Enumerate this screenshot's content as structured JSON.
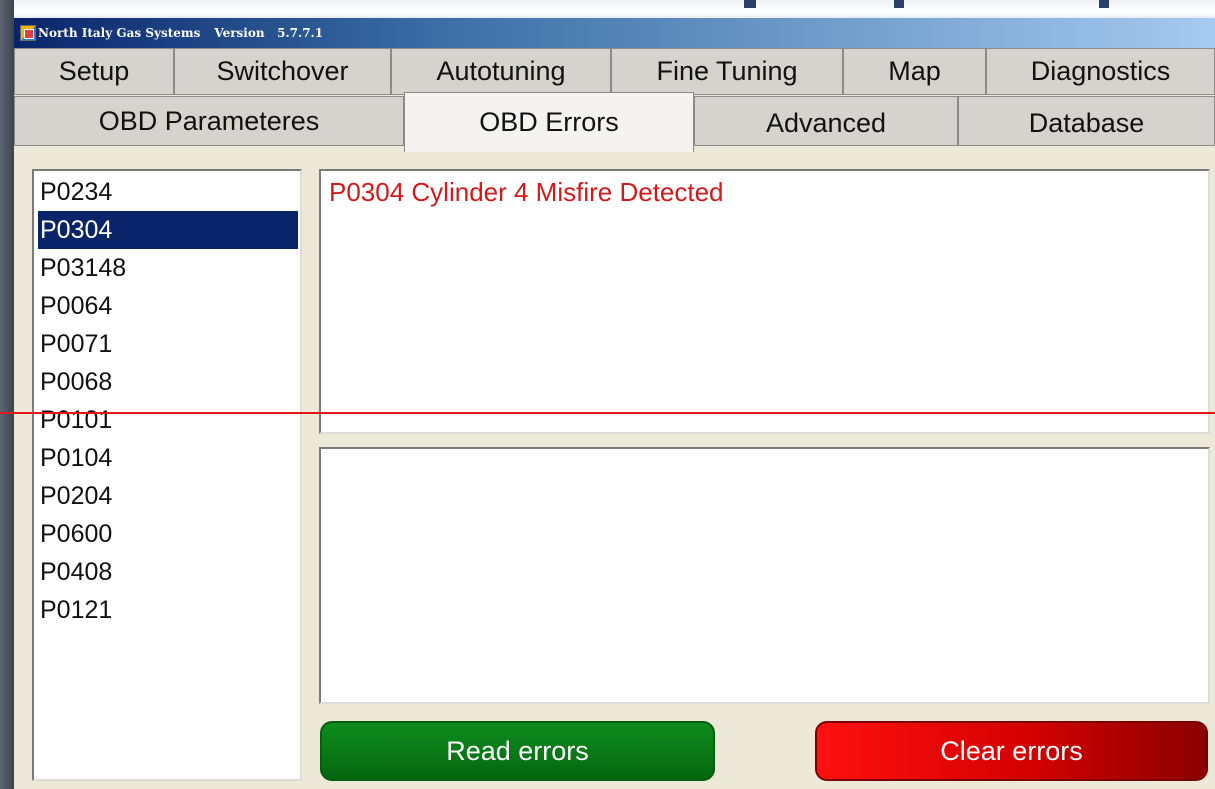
{
  "window": {
    "title": "North Italy Gas Systems",
    "version_label": "Version",
    "version": "5.7.7.1"
  },
  "tabs_row1": [
    "Setup",
    "Switchover",
    "Autotuning",
    "Fine Tuning",
    "Map",
    "Diagnostics"
  ],
  "tabs_row2": [
    "OBD Parameteres",
    "OBD Errors",
    "Advanced",
    "Database"
  ],
  "active_tab": "OBD Errors",
  "error_codes": [
    "P0234",
    "P0304",
    "P03148",
    "P0064",
    "P0071",
    "P0068",
    "P0101",
    "P0104",
    "P0204",
    "P0600",
    "P0408",
    "P0121"
  ],
  "selected_code": "P0304",
  "description": "P0304 Cylinder 4 Misfire Detected",
  "buttons": {
    "read": "Read errors",
    "clear": "Clear errors"
  },
  "colors": {
    "selection": "#0a246a",
    "description_text": "#d21a1a",
    "read_button": "#0a7a18",
    "clear_button": "#d40000"
  }
}
